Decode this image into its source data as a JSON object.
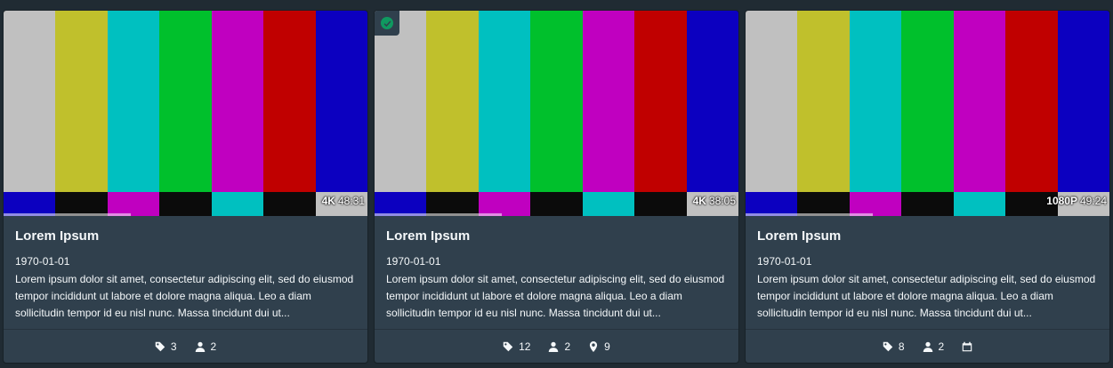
{
  "cards": [
    {
      "resolution": "4K",
      "duration": "48:31",
      "progress": 0.35,
      "selected": false,
      "title": "Lorem Ipsum",
      "date": "1970-01-01",
      "description": "Lorem ipsum dolor sit amet, consectetur adipiscing elit, sed do eiusmod tempor incididunt ut labore et dolore magna aliqua. Leo a diam sollicitudin tempor id eu nisl nunc. Massa tincidunt dui ut...",
      "tags_count": "3",
      "performers_count": "2"
    },
    {
      "resolution": "4K",
      "duration": "38:05",
      "progress": 0.35,
      "selected": true,
      "title": "Lorem Ipsum",
      "date": "1970-01-01",
      "description": "Lorem ipsum dolor sit amet, consectetur adipiscing elit, sed do eiusmod tempor incididunt ut labore et dolore magna aliqua. Leo a diam sollicitudin tempor id eu nisl nunc. Massa tincidunt dui ut...",
      "tags_count": "12",
      "performers_count": "2",
      "markers_count": "9"
    },
    {
      "resolution": "1080P",
      "duration": "49:24",
      "progress": 0.35,
      "selected": false,
      "title": "Lorem Ipsum",
      "date": "1970-01-01",
      "description": "Lorem ipsum dolor sit amet, consectetur adipiscing elit, sed do eiusmod tempor incididunt ut labore et dolore magna aliqua. Leo a diam sollicitudin tempor id eu nisl nunc. Massa tincidunt dui ut...",
      "tags_count": "8",
      "performers_count": "2"
    }
  ],
  "icons": {
    "tag": "tag-icon",
    "performer": "user-icon",
    "marker": "map-marker-icon",
    "calendar": "calendar-icon",
    "check": "check-circle-icon"
  },
  "colors": {
    "background": "#202b33",
    "card": "#30404d",
    "selected_check": "#0f9960"
  }
}
